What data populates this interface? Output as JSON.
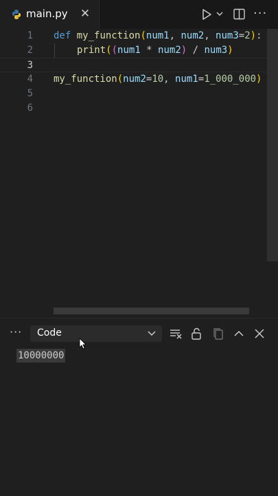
{
  "tab": {
    "filename": "main.py",
    "close_glyph": "✕"
  },
  "toolbar": {
    "more_glyph": "···"
  },
  "editor": {
    "line_numbers": [
      "1",
      "2",
      "3",
      "4",
      "5",
      "6"
    ],
    "tokens": {
      "l1_def": "def",
      "l1_fn": "my_function",
      "l1_p1": "(",
      "l1_arg1": "num1",
      "l1_sep1": ", ",
      "l1_arg2": "num2",
      "l1_sep2": ", ",
      "l1_arg3": "num3",
      "l1_eq": "=",
      "l1_def3": "2",
      "l1_p2": ")",
      "l1_colon": ":",
      "l2_print": "print",
      "l2_p1": "(",
      "l2_p2": "(",
      "l2_a": "num1",
      "l2_mul": " * ",
      "l2_b": "num2",
      "l2_p3": ")",
      "l2_div": " / ",
      "l2_c": "num3",
      "l2_p4": ")",
      "l4_fn": "my_function",
      "l4_p1": "(",
      "l4_k1": "num2",
      "l4_eq1": "=",
      "l4_v1": "10",
      "l4_sep": ", ",
      "l4_k2": "num1",
      "l4_eq2": "=",
      "l4_v2": "1_000_000",
      "l4_p2": ")"
    }
  },
  "panel": {
    "more_glyph": "···",
    "output_channel": "Code",
    "output_text": "10000000"
  },
  "colors": {
    "keyword": "#569cd6",
    "function": "#dcdcaa",
    "param": "#9cdcfe",
    "number": "#b5cea8"
  }
}
